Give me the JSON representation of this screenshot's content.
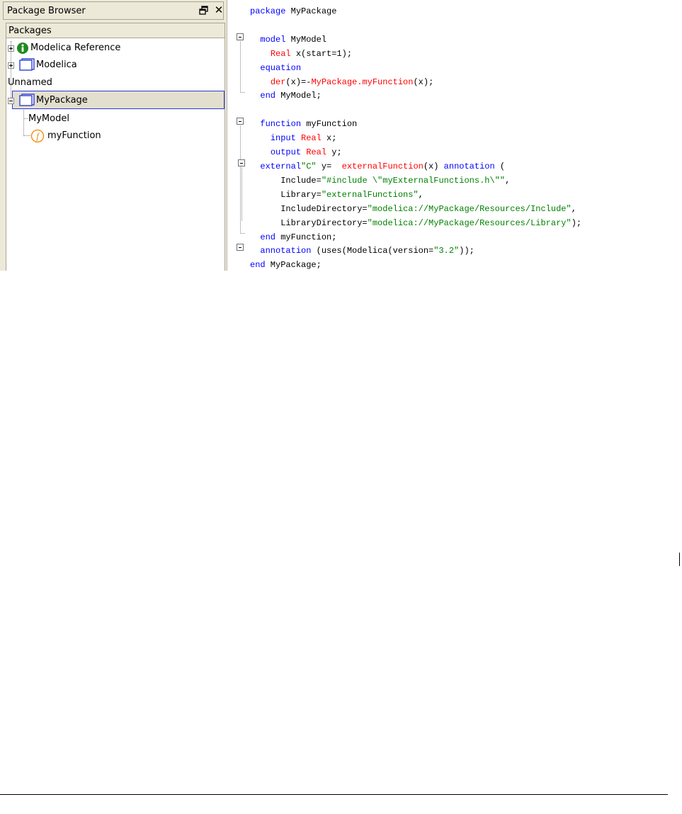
{
  "panel": {
    "title": "Package Browser",
    "tree_header": "Packages",
    "items": [
      {
        "label": "Modelica Reference",
        "icon": "info-icon",
        "expandable": true,
        "expanded": false
      },
      {
        "label": "Modelica",
        "icon": "package-icon",
        "expandable": true,
        "expanded": false
      },
      {
        "label": "Unnamed",
        "icon": "",
        "expandable": false
      },
      {
        "label": "MyPackage",
        "icon": "package-icon",
        "expandable": true,
        "expanded": true,
        "selected": true
      },
      {
        "label": "MyModel",
        "icon": "",
        "expandable": false,
        "child": true
      },
      {
        "label": "myFunction",
        "icon": "function-icon",
        "expandable": false,
        "child": true
      }
    ],
    "icon_colors": {
      "package": "#2e3fd6",
      "info": "#1f8a1f",
      "function": "#f08a00",
      "selection_border": "#2c3bd0"
    }
  },
  "code": {
    "colors": {
      "keyword": "#0000ff",
      "type": "#ff0000",
      "string": "#008000"
    },
    "lines": [
      [
        [
          "kw",
          "package"
        ],
        [
          "tx",
          " MyPackage"
        ]
      ],
      [
        [
          "tx",
          ""
        ]
      ],
      [
        [
          "tx",
          "  "
        ],
        [
          "kw",
          "model"
        ],
        [
          "tx",
          " MyModel"
        ]
      ],
      [
        [
          "tx",
          "    "
        ],
        [
          "ty",
          "Real"
        ],
        [
          "tx",
          " x(start=1);"
        ]
      ],
      [
        [
          "tx",
          "  "
        ],
        [
          "kw",
          "equation"
        ]
      ],
      [
        [
          "tx",
          "    "
        ],
        [
          "ty",
          "der"
        ],
        [
          "tx",
          "(x)=-"
        ],
        [
          "ty",
          "MyPackage.myFunction"
        ],
        [
          "tx",
          "(x);"
        ]
      ],
      [
        [
          "tx",
          "  "
        ],
        [
          "kw",
          "end"
        ],
        [
          "tx",
          " MyModel;"
        ]
      ],
      [
        [
          "tx",
          ""
        ]
      ],
      [
        [
          "tx",
          "  "
        ],
        [
          "kw",
          "function"
        ],
        [
          "tx",
          " myFunction"
        ]
      ],
      [
        [
          "tx",
          "    "
        ],
        [
          "kw",
          "input"
        ],
        [
          "tx",
          " "
        ],
        [
          "ty",
          "Real"
        ],
        [
          "tx",
          " x;"
        ]
      ],
      [
        [
          "tx",
          "    "
        ],
        [
          "kw",
          "output"
        ],
        [
          "tx",
          " "
        ],
        [
          "ty",
          "Real"
        ],
        [
          "tx",
          " y;"
        ]
      ],
      [
        [
          "tx",
          "  "
        ],
        [
          "kw",
          "external"
        ],
        [
          "st",
          "\"C\""
        ],
        [
          "tx",
          " y=  "
        ],
        [
          "ty",
          "externalFunction"
        ],
        [
          "tx",
          "(x) "
        ],
        [
          "kw",
          "annotation"
        ],
        [
          "tx",
          " ("
        ]
      ],
      [
        [
          "tx",
          "      Include="
        ],
        [
          "st",
          "\"#include \\\"myExternalFunctions.h\\\"\""
        ],
        [
          "tx",
          ","
        ]
      ],
      [
        [
          "tx",
          "      Library="
        ],
        [
          "st",
          "\"externalFunctions\""
        ],
        [
          "tx",
          ","
        ]
      ],
      [
        [
          "tx",
          "      IncludeDirectory="
        ],
        [
          "st",
          "\"modelica://MyPackage/Resources/Include\""
        ],
        [
          "tx",
          ","
        ]
      ],
      [
        [
          "tx",
          "      LibraryDirectory="
        ],
        [
          "st",
          "\"modelica://MyPackage/Resources/Library\""
        ],
        [
          "tx",
          ");"
        ]
      ],
      [
        [
          "tx",
          "  "
        ],
        [
          "kw",
          "end"
        ],
        [
          "tx",
          " myFunction;"
        ]
      ],
      [
        [
          "tx",
          "  "
        ],
        [
          "kw",
          "annotation"
        ],
        [
          "tx",
          " (uses(Modelica(version="
        ],
        [
          "st",
          "\"3.2\""
        ],
        [
          "tx",
          "));"
        ]
      ],
      [
        [
          "kw",
          "end"
        ],
        [
          "tx",
          " MyPackage;"
        ]
      ]
    ]
  }
}
